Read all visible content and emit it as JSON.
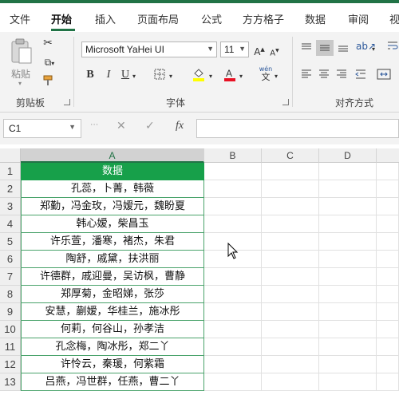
{
  "ribbon_tabs": [
    "文件",
    "开始",
    "插入",
    "页面布局",
    "公式",
    "方方格子",
    "数据",
    "审阅",
    "视"
  ],
  "clipboard": {
    "paste_label": "粘贴",
    "group_label": "剪贴板"
  },
  "font": {
    "name": "Microsoft YaHei UI",
    "size": "11",
    "group_label": "字体",
    "bold": "B",
    "italic": "I",
    "underline": "U",
    "phonetic_top": "wén",
    "phonetic_bottom": "文"
  },
  "alignment": {
    "group_label": "对齐方式"
  },
  "formula_bar": {
    "name_box": "C1",
    "cancel": "✕",
    "enter": "✓",
    "fx": "fx",
    "content": ""
  },
  "columns": [
    "A",
    "B",
    "C",
    "D"
  ],
  "selected_column": "A",
  "rows": [
    "1",
    "2",
    "3",
    "4",
    "5",
    "6",
    "7",
    "8",
    "9",
    "10",
    "11",
    "12",
    "13"
  ],
  "colA": [
    "数据",
    "孔蕊，卜菁，韩薇",
    "郑勤，冯金玫，冯嫒元，魏盼夏",
    "韩心嫒，柴昌玉",
    "许乐萱，潘寒，褚杰，朱君",
    "陶舒，戚黛，扶洪丽",
    "许德群，戚迎曼，吴访枫，曹静",
    "郑厚菊，金昭娣，张莎",
    "安慧，蒯嫒，华桂兰，施冰彤",
    "何莉，何谷山，孙孝洁",
    "孔念梅，陶冰彤，郑二丫",
    "许怜云，秦瑗，何紫霜",
    "吕燕，冯世群，任燕，曹二丫"
  ],
  "colors": {
    "accent": "#217346",
    "header_fill": "#17a04a",
    "header_text": "#ffffff"
  }
}
